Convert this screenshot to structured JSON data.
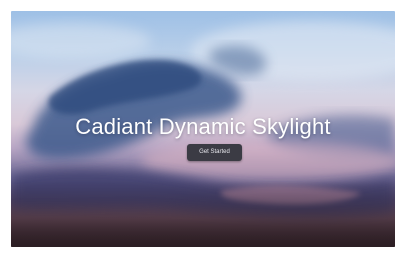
{
  "hero": {
    "title": "Cadiant Dynamic Skylight",
    "button_label": "Get Started"
  }
}
